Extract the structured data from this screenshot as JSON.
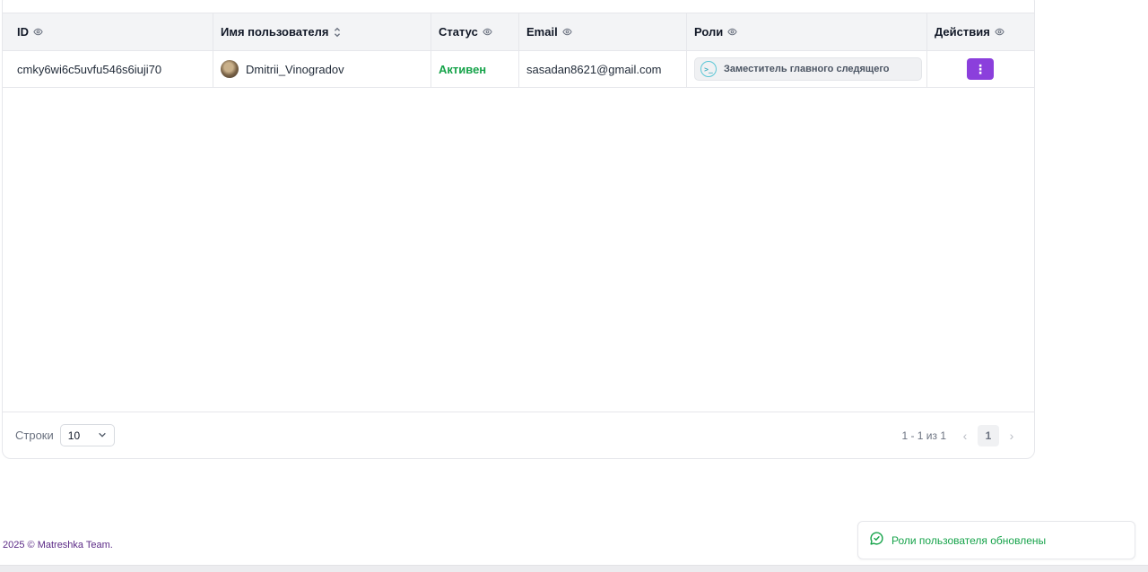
{
  "table": {
    "columns": {
      "id": "ID",
      "username": "Имя пользователя",
      "status": "Статус",
      "email": "Email",
      "roles": "Роли",
      "actions": "Действия"
    },
    "rows": [
      {
        "id": "cmky6wi6c5uvfu546s6iuji70",
        "username": "Dmitrii_Vinogradov",
        "status": "Активен",
        "email": "sasadan8621@gmail.com",
        "role": "Заместитель главного следящего",
        "role_icon": ">_",
        "actions_icon": "⋮"
      }
    ]
  },
  "pagination": {
    "rows_label": "Строки",
    "rows_per_page": "10",
    "range_text": "1 - 1 из 1",
    "current_page": "1",
    "prev_icon": "‹",
    "next_icon": "›"
  },
  "footer": {
    "copyright": "2025 © Matreshka Team."
  },
  "toast": {
    "message": "Роли пользователя обновлены"
  },
  "colors": {
    "accent": "#8b3fdc",
    "success": "#16a34a",
    "header_bg": "#f3f4f6",
    "role_icon": "#5bc7d6"
  },
  "icons": {
    "column_visibility": "eye-icon",
    "sort": "sort-icon",
    "toast": "message-check-icon",
    "select": "chevron-down-icon",
    "prev": "chevron-left-icon",
    "next": "chevron-right-icon"
  }
}
